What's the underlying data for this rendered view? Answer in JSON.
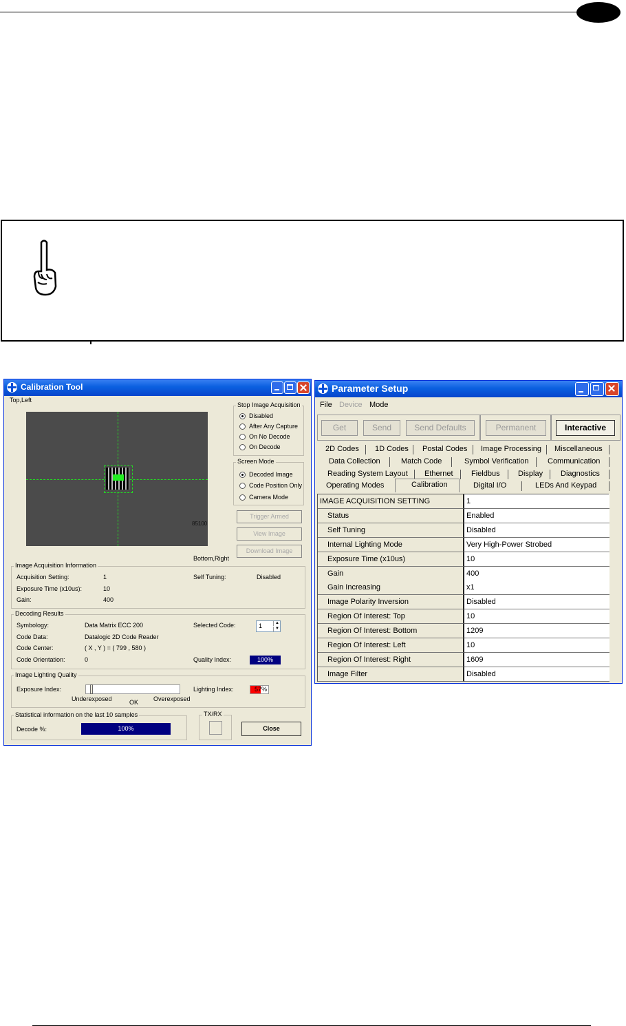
{
  "calibration": {
    "title": "Calibration Tool",
    "corner_top_left": "Top,Left",
    "corner_bottom_right": "Bottom,Right",
    "image_code_fragment": "85100",
    "stop_acquisition": {
      "title": "Stop Image Acquisition",
      "options": [
        "Disabled",
        "After Any Capture",
        "On No Decode",
        "On Decode"
      ],
      "selected": 0
    },
    "screen_mode": {
      "title": "Screen Mode",
      "options": [
        "Decoded Image",
        "Code Position Only",
        "Camera Mode"
      ],
      "selected": 0
    },
    "buttons": {
      "trigger": "Trigger Armed",
      "view": "View Image",
      "download": "Download Image",
      "close": "Close"
    },
    "acq_info": {
      "title": "Image Acquisition Information",
      "acq_label": "Acquisition Setting:",
      "acq_value": "1",
      "exp_label": "Exposure Time (x10us):",
      "exp_value": "10",
      "gain_label": "Gain:",
      "gain_value": "400",
      "self_label": "Self Tuning:",
      "self_value": "Disabled"
    },
    "decoding": {
      "title": "Decoding Results",
      "symbology_label": "Symbology:",
      "symbology_value": "Data Matrix ECC 200",
      "codedata_label": "Code Data:",
      "codedata_value": "Datalogic 2D Code Reader",
      "center_label": "Code Center:",
      "center_value": "( X , Y ) = ( 799 , 580 )",
      "orient_label": "Code Orientation:",
      "orient_value": "0",
      "selected_label": "Selected Code:",
      "selected_value": "1",
      "quality_label": "Quality Index:",
      "quality_value": "100%"
    },
    "lighting": {
      "title": "Image Lighting Quality",
      "exposure_label": "Exposure Index:",
      "under": "Underexposed",
      "ok": "OK",
      "over": "Overexposed",
      "lighting_label": "Lighting Index:",
      "lighting_value": "57%"
    },
    "stats": {
      "title": "Statistical information on the last 10 samples",
      "decode_label": "Decode %:",
      "decode_value": "100%"
    },
    "txrx": "TX/RX"
  },
  "parameter_setup": {
    "title": "Parameter Setup",
    "menu": [
      "File",
      "Device",
      "Mode"
    ],
    "toolbar": [
      "Get",
      "Send",
      "Send Defaults",
      "Permanent",
      "Interactive"
    ],
    "tab_rows": [
      [
        "2D Codes",
        "1D Codes",
        "Postal Codes",
        "Image Processing",
        "Miscellaneous"
      ],
      [
        "Data Collection",
        "Match Code",
        "Symbol Verification",
        "Communication"
      ],
      [
        "Reading System Layout",
        "Ethernet",
        "Fieldbus",
        "Display",
        "Diagnostics"
      ],
      [
        "Operating Modes",
        "Calibration",
        "Digital I/O",
        "LEDs And Keypad"
      ]
    ],
    "active_tab": "Calibration",
    "rows": [
      {
        "name": "IMAGE ACQUISITION SETTING",
        "value": "1"
      },
      {
        "name": "Status",
        "value": "Enabled"
      },
      {
        "name": "Self Tuning",
        "value": "Disabled"
      },
      {
        "name": "Internal Lighting Mode",
        "value": "Very High-Power Strobed"
      },
      {
        "name": "Exposure Time (x10us)",
        "value": "10"
      },
      {
        "name": "Gain",
        "value": "400"
      },
      {
        "name": "Gain Increasing",
        "value": "x1"
      },
      {
        "name": "Image Polarity Inversion",
        "value": "Disabled"
      },
      {
        "name": "Region Of Interest: Top",
        "value": "10"
      },
      {
        "name": "Region Of Interest: Bottom",
        "value": "1209"
      },
      {
        "name": "Region Of Interest: Left",
        "value": "10"
      },
      {
        "name": "Region Of Interest: Right",
        "value": "1609"
      },
      {
        "name": "Image Filter",
        "value": "Disabled"
      }
    ]
  },
  "note_icon": "pointing-hand-icon"
}
